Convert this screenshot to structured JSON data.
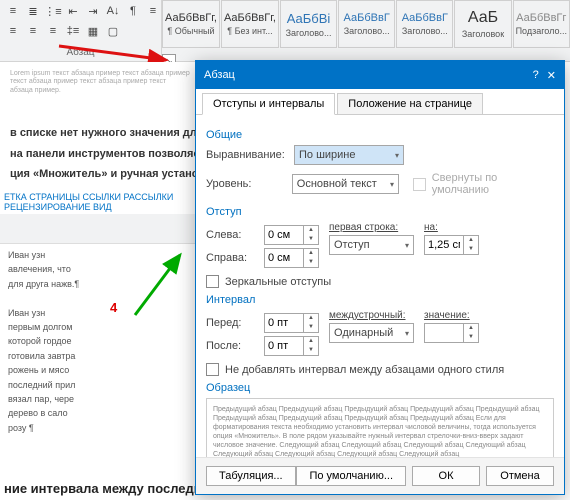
{
  "ribbon": {
    "group_para": "Абзац",
    "styles": [
      {
        "prev": "АаБбВвГг,",
        "name": "¶ Обычный"
      },
      {
        "prev": "АаБбВвГг,",
        "name": "¶ Без инт..."
      },
      {
        "prev": "АаБбВі",
        "name": "Заголово..."
      },
      {
        "prev": "АаБбВвГ",
        "name": "Заголово..."
      },
      {
        "prev": "АаБбВвГ",
        "name": "Заголово..."
      },
      {
        "prev": "АаБ",
        "name": "Заголовок"
      },
      {
        "prev": "АаБбВвГг",
        "name": "Подзаголо..."
      }
    ]
  },
  "doc": {
    "l1": "в списке нет нужного значения для",
    "l2": "на панели инструментов позволяет с",
    "l3": "ция «Множитель» и ручная установка",
    "bottom": "ние интервала между последними"
  },
  "mini_ribbon": {
    "tabs": "ЕТКА СТРАНИЦЫ   ССЫЛКИ   РАССЫЛКИ   РЕЦЕНЗИРОВАНИЕ   ВИД"
  },
  "red_marker": "4",
  "dlg": {
    "title": "Абзац",
    "help": "?",
    "close": "✕",
    "tab1": "Отступы и интервалы",
    "tab2": "Положение на странице",
    "g_common": "Общие",
    "align_lbl": "Выравнивание:",
    "align_val": "По ширине",
    "level_lbl": "Уровень:",
    "level_val": "Основной текст",
    "collapse": "Свернуты по умолчанию",
    "g_indent": "Отступ",
    "left_lbl": "Слева:",
    "left_val": "0 см",
    "right_lbl": "Справа:",
    "right_val": "0 см",
    "first_lbl": "первая строка:",
    "first_val": "Отступ",
    "on_lbl": "на:",
    "on_val": "1,25 см",
    "mirror": "Зеркальные отступы",
    "g_spacing": "Интервал",
    "before_lbl": "Перед:",
    "before_val": "0 пт",
    "after_lbl": "После:",
    "after_val": "0 пт",
    "line_lbl": "междустрочный:",
    "line_val": "Одинарный",
    "value_lbl": "значение:",
    "value_val": "",
    "noadd": "Не добавлять интервал между абзацами одного стиля",
    "g_preview": "Образец",
    "preview_text": "Предыдущий абзац Предыдущий абзац Предыдущий абзац Предыдущий абзац Предыдущий абзац Предыдущий абзац Предыдущий абзац Предыдущий абзац Предыдущий абзац\n    Если для форматирования текста необходимо установить интервал числовой величины, тогда используется опция «Множитель». В поле рядом указывайте нужный интервал стрелочки-вниз-вверх задают числовое значение.\nСледующий абзац Следующий абзац Следующий абзац Следующий абзац Следующий абзац Следующий абзац Следующий абзац Следующий абзац",
    "btn_tab": "Табуляция...",
    "btn_def": "По умолчанию...",
    "btn_ok": "ОК",
    "btn_cancel": "Отмена"
  }
}
